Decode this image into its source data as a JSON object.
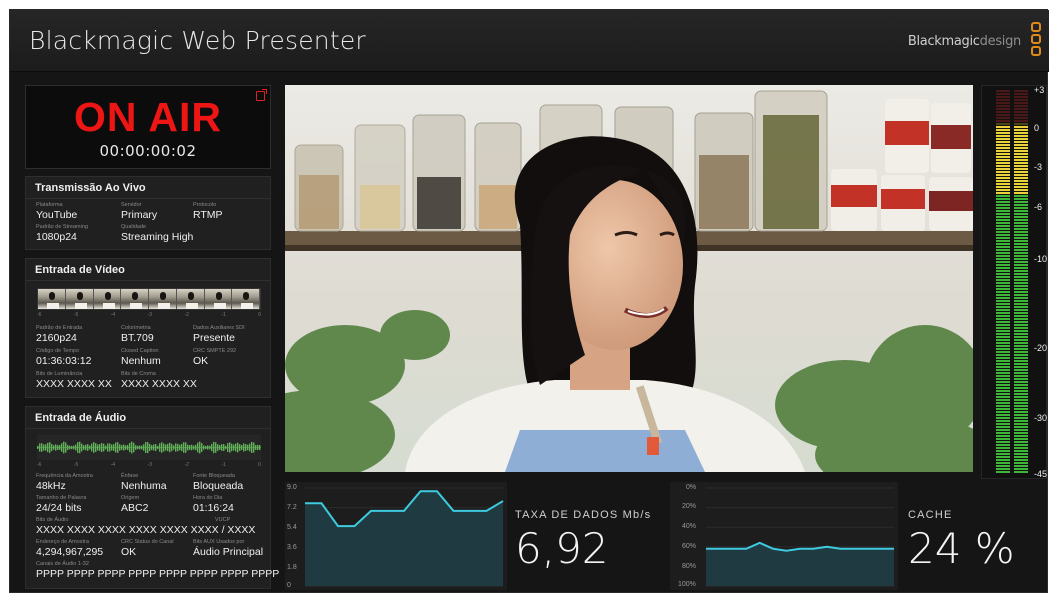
{
  "app": {
    "title": "Blackmagic Web Presenter",
    "brand_main": "Blackmagic",
    "brand_sub": "design"
  },
  "onair": {
    "label": "ON AIR",
    "timecode": "00:00:00:02"
  },
  "stream": {
    "title": "Transmissão Ao Vivo",
    "fields": [
      {
        "label": "Plataforma",
        "value": "YouTube"
      },
      {
        "label": "Servidor",
        "value": "Primary"
      },
      {
        "label": "Protocolo",
        "value": "RTMP"
      },
      {
        "label": "Padrão de Streaming",
        "value": "1080p24"
      },
      {
        "label": "Qualidade",
        "value": "Streaming High"
      }
    ]
  },
  "video_input": {
    "title": "Entrada de Vídeo",
    "scale": [
      "-6",
      "-5",
      "-4",
      "-3",
      "-2",
      "-1",
      "0"
    ],
    "fields": [
      {
        "label": "Padrão de Entrada",
        "value": "2160p24"
      },
      {
        "label": "Colorimetria",
        "value": "BT.709"
      },
      {
        "label": "Dados Auxiliares SDI",
        "value": "Presente"
      },
      {
        "label": "Código de Tempo",
        "value": "01:36:03:12"
      },
      {
        "label": "Closed Caption",
        "value": "Nenhum"
      },
      {
        "label": "CRC SMPTE 292",
        "value": "OK"
      },
      {
        "label": "Bits de Luminância",
        "value": "XXXX XXXX XX"
      },
      {
        "label": "Bits de Croma",
        "value": "XXXX XXXX XX"
      }
    ]
  },
  "audio_input": {
    "title": "Entrada de Áudio",
    "scale": [
      "-6",
      "-5",
      "-4",
      "-3",
      "-2",
      "-1",
      "0"
    ],
    "fields": [
      {
        "label": "Frequência da Amostra",
        "value": "48kHz"
      },
      {
        "label": "Ênfase",
        "value": "Nenhuma"
      },
      {
        "label": "Fonte Bloqueada",
        "value": "Bloqueada"
      },
      {
        "label": "Tamanho de Palavra",
        "value": "24/24 bits"
      },
      {
        "label": "Origem",
        "value": "ABC2"
      },
      {
        "label": "Hora do Dia",
        "value": "01:16:24"
      },
      {
        "label": "Bits de Áudio",
        "value": "XXXX XXXX XXXX XXXX XXXX XXXX / XXXX"
      },
      {
        "label": "VUCP",
        "value": ""
      },
      {
        "label": "Endereço de Amostra",
        "value": "4,294,967,295"
      },
      {
        "label": "CRC Status do Canal",
        "value": "OK"
      },
      {
        "label": "Bits AUX Usados por",
        "value": "Áudio Principal"
      },
      {
        "label": "Canais de Áudio 1-32",
        "value": "PPPP PPPP PPPP PPPP PPPP PPPP PPPP PPPP"
      }
    ]
  },
  "meters": {
    "scale": [
      "+3",
      "0",
      "-3",
      "-6",
      "-10",
      "-20",
      "-30",
      "-45"
    ],
    "levels_db": [
      -1.5,
      -1.5
    ]
  },
  "data_rate": {
    "label": "TAXA DE DADOS Mb/s",
    "value": "6,92",
    "ticks": [
      "9.0",
      "7.2",
      "5.4",
      "3.6",
      "1.8",
      "0"
    ],
    "colors": {
      "line": "#3ecbe0",
      "fill": "#1f3a40"
    }
  },
  "cache": {
    "label": "CACHE",
    "value": "24 %",
    "ticks": [
      "0%",
      "20%",
      "40%",
      "60%",
      "80%",
      "100%"
    ]
  },
  "chart_data": [
    {
      "type": "line",
      "ylabel": "TAXA DE DADOS Mb/s",
      "ylim": [
        0,
        9.0
      ],
      "values": [
        7.6,
        7.6,
        5.5,
        5.5,
        6.9,
        6.9,
        6.9,
        8.7,
        8.7,
        6.9,
        6.9,
        6.9,
        7.8
      ]
    },
    {
      "type": "line",
      "ylabel": "CACHE",
      "ylim": [
        0,
        100
      ],
      "y_inverted": true,
      "values": [
        62,
        62,
        62,
        62,
        56,
        62,
        64,
        62,
        62,
        60,
        62,
        62,
        62,
        62,
        62
      ]
    }
  ]
}
